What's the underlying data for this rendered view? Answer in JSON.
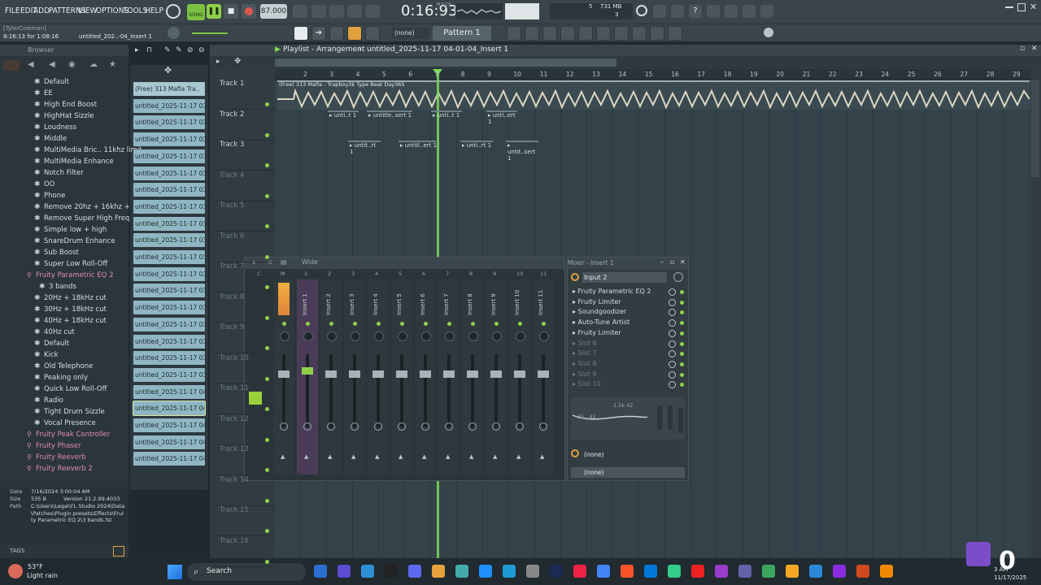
{
  "menu": {
    "items": [
      "FILE",
      "EDIT",
      "ADD",
      "PATTERNS",
      "VIEW",
      "OPTIONS",
      "TOOLS",
      "HELP"
    ],
    "song_label": "SONG",
    "tempo": "87.000",
    "time": "0:16:93",
    "time_unit": "M:S:CS",
    "mem": "731 MB",
    "cpu_top": "5",
    "cpu_bottom": "3"
  },
  "hint": {
    "user": "[TylerColeman]",
    "time_info": "8:16:13 for 1:08:16",
    "project": "untitled_202..-04_Insert 1"
  },
  "toolbar2": {
    "pattern": "Pattern 1",
    "none_select": "(none)"
  },
  "browser": {
    "title": "Browser",
    "items": [
      {
        "label": "Default",
        "type": "preset"
      },
      {
        "label": "EE",
        "type": "preset"
      },
      {
        "label": "High End Boost",
        "type": "preset"
      },
      {
        "label": "HighHat Sizzle",
        "type": "preset"
      },
      {
        "label": "Loudness",
        "type": "preset"
      },
      {
        "label": "Middle",
        "type": "preset"
      },
      {
        "label": "MultiMedia Bric.. 11khz limit",
        "type": "preset"
      },
      {
        "label": "MultiMedia Enhance",
        "type": "preset"
      },
      {
        "label": "Notch Filter",
        "type": "preset"
      },
      {
        "label": "OO",
        "type": "preset"
      },
      {
        "label": "Phone",
        "type": "preset"
      },
      {
        "label": "Remove 20hz + 16khz +",
        "type": "preset"
      },
      {
        "label": "Remove Super High Freq",
        "type": "preset"
      },
      {
        "label": "Simple low + high",
        "type": "preset"
      },
      {
        "label": "SnareDrum Enhance",
        "type": "preset"
      },
      {
        "label": "Sub Boost",
        "type": "preset"
      },
      {
        "label": "Super Low Roll-Off",
        "type": "preset"
      },
      {
        "label": "Fruity Parametric EQ 2",
        "type": "plugin"
      },
      {
        "label": "3 bands",
        "type": "folder"
      },
      {
        "label": "20Hz + 18kHz cut",
        "type": "preset"
      },
      {
        "label": "30Hz + 18kHz cut",
        "type": "preset"
      },
      {
        "label": "40Hz + 18kHz cut",
        "type": "preset"
      },
      {
        "label": "40Hz cut",
        "type": "preset"
      },
      {
        "label": "Default",
        "type": "preset"
      },
      {
        "label": "Kick",
        "type": "preset"
      },
      {
        "label": "Old Telephone",
        "type": "preset"
      },
      {
        "label": "Peaking only",
        "type": "preset"
      },
      {
        "label": "Quick Low Roll-Off",
        "type": "preset"
      },
      {
        "label": "Radio",
        "type": "preset"
      },
      {
        "label": "Tight Drum Sizzle",
        "type": "preset"
      },
      {
        "label": "Vocal Presence",
        "type": "preset"
      },
      {
        "label": "Fruity Peak Controller",
        "type": "plugin"
      },
      {
        "label": "Fruity Phaser",
        "type": "plugin"
      },
      {
        "label": "Fruity Reeverb",
        "type": "plugin"
      },
      {
        "label": "Fruity Reeverb 2",
        "type": "plugin"
      }
    ],
    "info": {
      "date_label": "Date",
      "date": "7/16/2024 3:00:04 AM",
      "size_label": "Size",
      "size": "535 B",
      "version_label": "Version 21.2.99.4033",
      "path_label": "Path",
      "path": "C:\\Users\\Legal\\FL Studio 2024\\Data\\Patches\\Plugin presets\\Effects\\Fruity Parametric EQ 2\\3 bands.fst"
    },
    "tags_label": "TAGS"
  },
  "patterns": [
    "(Free) 313 Mafia Tra..",
    "untitled_2025-11-17 03-..",
    "untitled_2025-11-17 03-..",
    "untitled_2025-11-17 03-..",
    "untitled_2025-11-17 03-..",
    "untitled_2025-11-17 03-..",
    "untitled_2025-11-17 03-..",
    "untitled_2025-11-17 03-..",
    "untitled_2025-11-17 03-..",
    "untitled_2025-11-17 03-..",
    "untitled_2025-11-17 03-..",
    "untitled_2025-11-17 03-..",
    "untitled_2025-11-17 03-..",
    "untitled_2025-11-17 03-..",
    "untitled_2025-11-17 03-..",
    "untitled_2025-11-17 03-..",
    "untitled_2025-11-17 03-..",
    "untitled_2025-11-17 03-..",
    "untitled_2025-11-17 04-..",
    "untitled_2025-11-17 04-..",
    "untitled_2025-11-17 04-..",
    "untitled_2025-11-17 04-..",
    "untitled_2025-11-17 04-.."
  ],
  "playlist": {
    "title": "Playlist - Arrangement",
    "sep": "›",
    "pattern_name": "untitled_2025-11-17 04-01-04_Insert 1",
    "ruler": [
      "2",
      "3",
      "4",
      "5",
      "6",
      "7",
      "8",
      "9",
      "10",
      "11",
      "12",
      "13",
      "14",
      "15",
      "16",
      "17",
      "18",
      "19",
      "20",
      "21",
      "22",
      "23",
      "24",
      "25",
      "26",
      "27",
      "28",
      "29"
    ],
    "tracks": [
      "Track 1",
      "Track 2",
      "Track 3",
      "Track 4",
      "Track 5",
      "Track 6",
      "Track 7",
      "Track 8",
      "Track 9",
      "Track 10",
      "Track 11",
      "Track 12",
      "Track 13",
      "Track 14",
      "Track 15",
      "Track 16"
    ],
    "audio_clip": "(Free) 313 Mafia - Trapboy3k Type Beat Day365",
    "track2_clips": [
      "unti..t 1",
      "untitle..sert 1",
      "unti..t 1",
      "unti..ert 1"
    ],
    "track3_clips": [
      "untit..rt 1",
      "untitl..ert 1",
      "unti..rt 1",
      "untit..sert 1"
    ]
  },
  "mixer": {
    "preset": "Wide",
    "title": "Mixer - Insert 1",
    "strip_numbers": [
      "C",
      "M",
      "1",
      "2",
      "3",
      "4",
      "5",
      "6",
      "7",
      "8",
      "9",
      "10",
      "11"
    ],
    "strip_names": [
      "Master",
      "Insert 1",
      "Insert 2",
      "Insert 3",
      "Insert 4",
      "Insert 5",
      "Insert 6",
      "Insert 7",
      "Insert 8",
      "Insert 9",
      "Insert 10",
      "Insert 11"
    ],
    "input": "Input 2",
    "slots": [
      {
        "label": "Fruity Parametric EQ 2",
        "active": true
      },
      {
        "label": "Fruity Limiter",
        "active": true
      },
      {
        "label": "Soundgoodizer",
        "active": true
      },
      {
        "label": "Auto-Tune Artist",
        "active": true
      },
      {
        "label": "Fruity Limiter",
        "active": true
      },
      {
        "label": "Slot 6",
        "active": false
      },
      {
        "label": "Slot 7",
        "active": false
      },
      {
        "label": "Slot 8",
        "active": false
      },
      {
        "label": "Slot 9",
        "active": false
      },
      {
        "label": "Slot 10",
        "active": false
      }
    ],
    "eq_freq": "1.5k 42",
    "eq_low": "35 ..42",
    "out_top": "(none)",
    "out_bottom": "(none)"
  },
  "taskbar": {
    "temp": "53°F",
    "weather": "Light rain",
    "search": "Search",
    "time": "3 AM",
    "date": "11/17/2025",
    "overlay_number": "0"
  },
  "colors": {
    "accent_green": "#8fd14a",
    "playhead": "#7ed957",
    "clip_pattern": "#8fb6c2",
    "plugin_pink": "#e08ab1"
  }
}
